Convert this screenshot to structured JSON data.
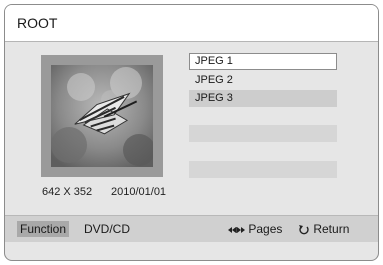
{
  "header": {
    "title": "ROOT"
  },
  "preview": {
    "resolution": "642 X 352",
    "date": "2010/01/01"
  },
  "files": [
    {
      "name": "JPEG 1",
      "state": "selected"
    },
    {
      "name": "JPEG 2",
      "state": "normal"
    },
    {
      "name": "JPEG 3",
      "state": "shaded"
    }
  ],
  "footer": {
    "function_label": "Function",
    "source_label": "DVD/CD",
    "pages_label": "Pages",
    "return_label": "Return",
    "pages_icon": "page-arrows-icon",
    "return_icon": "return-arrow-icon"
  },
  "colors": {
    "background": "#e6e6e6",
    "frame": "#9a9a9a",
    "selected": "#ffffff",
    "highlight": "#cdcdcd"
  }
}
